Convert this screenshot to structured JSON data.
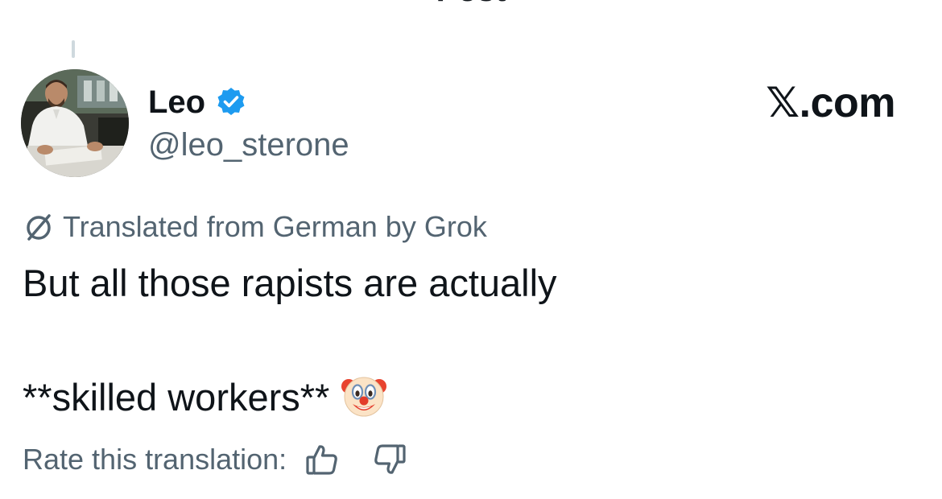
{
  "header": {
    "title": "Post",
    "back_icon": "chevron-left-icon"
  },
  "post": {
    "author": {
      "display_name": "Leo",
      "handle": "@leo_sterone",
      "verified": true,
      "verified_color": "#1d9bf0",
      "avatar_icon": "user-avatar"
    },
    "source_mark": "𝕏.com",
    "translation_note": "Translated from German by Grok",
    "translation_icon": "grok-icon",
    "text_lines": [
      "But all those rapists are actually",
      "**skilled workers**"
    ],
    "emoji": "clown-face-emoji",
    "rate": {
      "label": "Rate this translation:",
      "up_icon": "thumbs-up-icon",
      "down_icon": "thumbs-down-icon"
    }
  },
  "colors": {
    "text_primary": "#0f1419",
    "text_secondary": "#536471",
    "verified_blue": "#1d9bf0",
    "thread_line": "#cfd9de"
  }
}
